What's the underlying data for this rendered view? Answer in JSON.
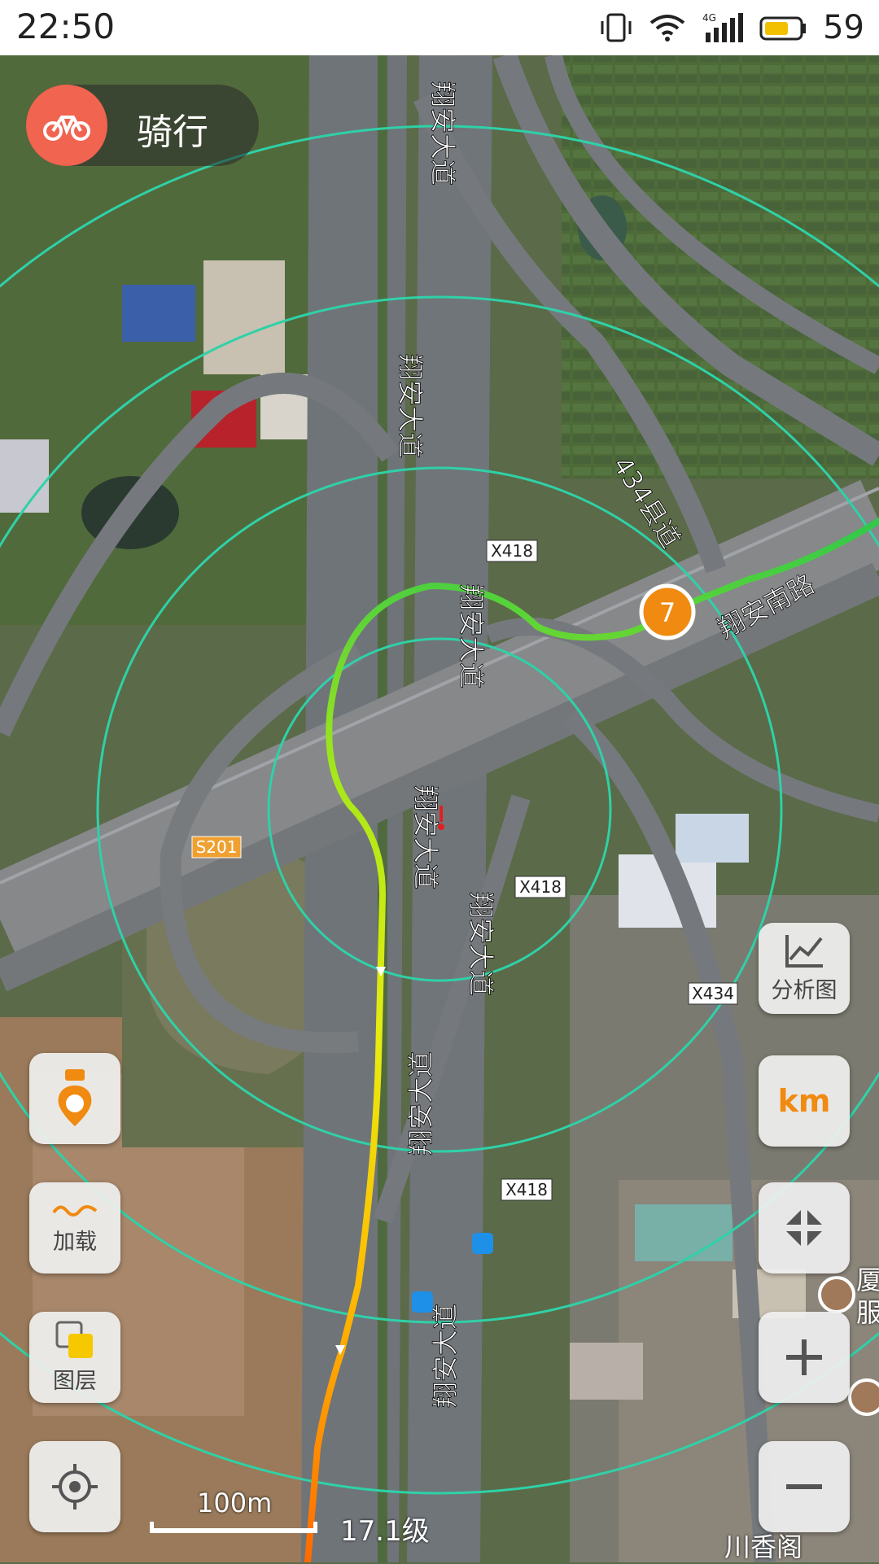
{
  "status_bar": {
    "time": "22:50",
    "network": "4G",
    "battery_percent": "59"
  },
  "mode": {
    "label": "骑行",
    "icon": "bicycle-icon",
    "color": "#f06450"
  },
  "map": {
    "route_colors": [
      "#ff6a00",
      "#ffd400",
      "#d8f000",
      "#7fe01a",
      "#2fc84a"
    ],
    "rings_color": "#2fd1a8",
    "km_marker": "7",
    "road_labels": [
      {
        "text": "翔安大道"
      },
      {
        "text": "翔安大道"
      },
      {
        "text": "翔安大道"
      },
      {
        "text": "翔安大道"
      },
      {
        "text": "翔安大道"
      },
      {
        "text": "翔安大道"
      },
      {
        "text": "翔安大道"
      },
      {
        "text": "434县道"
      },
      {
        "text": "翔安南路"
      }
    ],
    "shields": [
      {
        "text": "X418"
      },
      {
        "text": "X418"
      },
      {
        "text": "X418"
      },
      {
        "text": "S201"
      },
      {
        "text": "X434"
      }
    ],
    "pois": [
      {
        "text": "川香阁"
      },
      {
        "text": "厦"
      },
      {
        "text": "服"
      }
    ]
  },
  "left_controls": {
    "footprint_icon": "footprint-pin-icon",
    "load_label": "加载",
    "layers_label": "图层",
    "locate_icon": "locate-icon"
  },
  "right_controls": {
    "analysis_label": "分析图",
    "km_label": "km",
    "collapse_icon": "collapse-icon",
    "zoom_in_icon": "plus-icon",
    "zoom_out_icon": "minus-icon"
  },
  "scale": {
    "distance": "100m",
    "zoom_level": "17.1级"
  }
}
